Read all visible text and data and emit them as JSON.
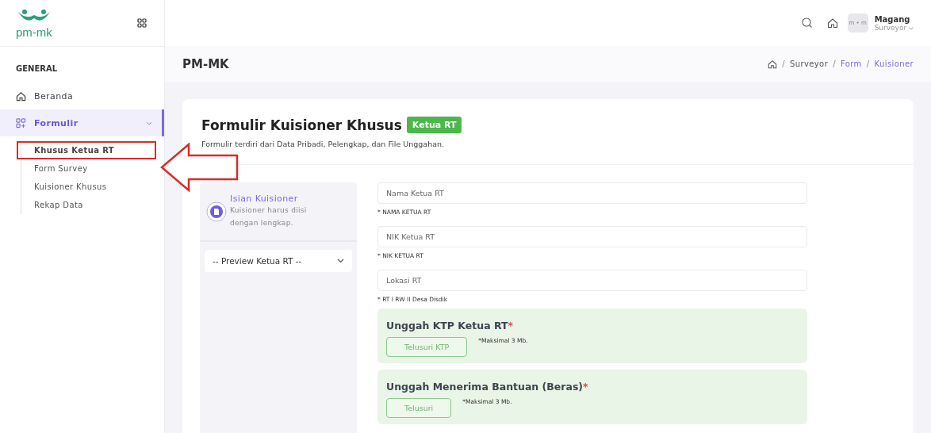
{
  "logo": {
    "text": "pm-mk"
  },
  "topbar": {
    "user_name": "Magang",
    "user_role": "Surveyor",
    "avatar_text": "m • m"
  },
  "breadcrumb_separator": "/",
  "page_title": "PM-MK",
  "breadcrumb": [
    {
      "label": "Surveyor",
      "link": false
    },
    {
      "label": "Form",
      "link": true
    },
    {
      "label": "Kuisioner",
      "link": true
    }
  ],
  "sidebar": {
    "section": "GENERAL",
    "items": [
      {
        "label": "Beranda",
        "selected": false
      },
      {
        "label": "Formulir",
        "selected": true,
        "expanded": true,
        "children": [
          {
            "label": "Khusus Ketua RT",
            "selected": true
          },
          {
            "label": "Form Survey",
            "selected": false
          },
          {
            "label": "Kuisioner Khusus",
            "selected": false
          },
          {
            "label": "Rekap Data",
            "selected": false
          }
        ]
      }
    ]
  },
  "annotation": {
    "highlight": true
  },
  "form": {
    "title": "Formulir Kuisioner Khusus",
    "badge": "Ketua RT",
    "subtitle": "Formulir terdiri dari Data Pribadi, Pelengkap, dan File Unggahan.",
    "panel": {
      "title": "Isian Kuisioner",
      "description": "Kuisioner harus diisi dengan lengkap.",
      "select_value": "-- Preview Ketua RT --"
    },
    "fields": [
      {
        "placeholder": "Nama Ketua RT",
        "hint": "* NAMA KETUA RT"
      },
      {
        "placeholder": "NIK Ketua RT",
        "hint": "* NIK KETUA RT"
      },
      {
        "placeholder": "Lokasi RT",
        "hint": "* RT I RW II Desa Disdik"
      }
    ],
    "required_mark": "*",
    "uploads": [
      {
        "title": "Unggah KTP Ketua RT",
        "required": true,
        "button": "Telusuri KTP",
        "note": "*Maksimal 3 Mb."
      },
      {
        "title": "Unggah Menerima Bantuan (Beras)",
        "required": true,
        "button": "Telusuri",
        "note": "*Maksimal 3 Mb."
      }
    ]
  }
}
